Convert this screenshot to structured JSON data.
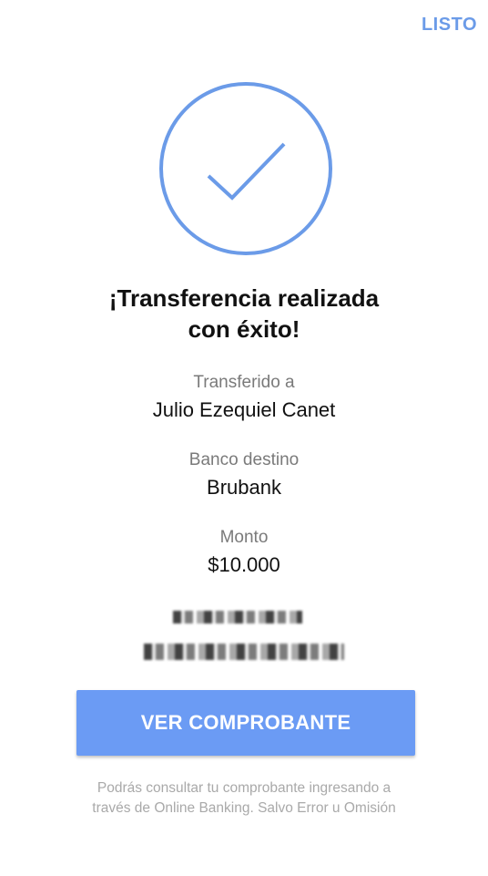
{
  "header": {
    "done_label": "LISTO"
  },
  "status": {
    "icon": "check-circle-icon",
    "accent_color": "#6b9be8",
    "title_line1": "¡Transferencia realizada",
    "title_line2": "con éxito!"
  },
  "details": [
    {
      "label": "Transferido a",
      "value": "Julio Ezequiel Canet"
    },
    {
      "label": "Banco destino",
      "value": "Brubank"
    },
    {
      "label": "Monto",
      "value": "$10.000"
    }
  ],
  "actions": {
    "view_receipt_label": "VER COMPROBANTE",
    "button_color": "#6b9bf4"
  },
  "footer": {
    "note_line1": "Podrás consultar tu comprobante ingresando a",
    "note_line2": "través de Online Banking. Salvo Error u Omisión"
  }
}
